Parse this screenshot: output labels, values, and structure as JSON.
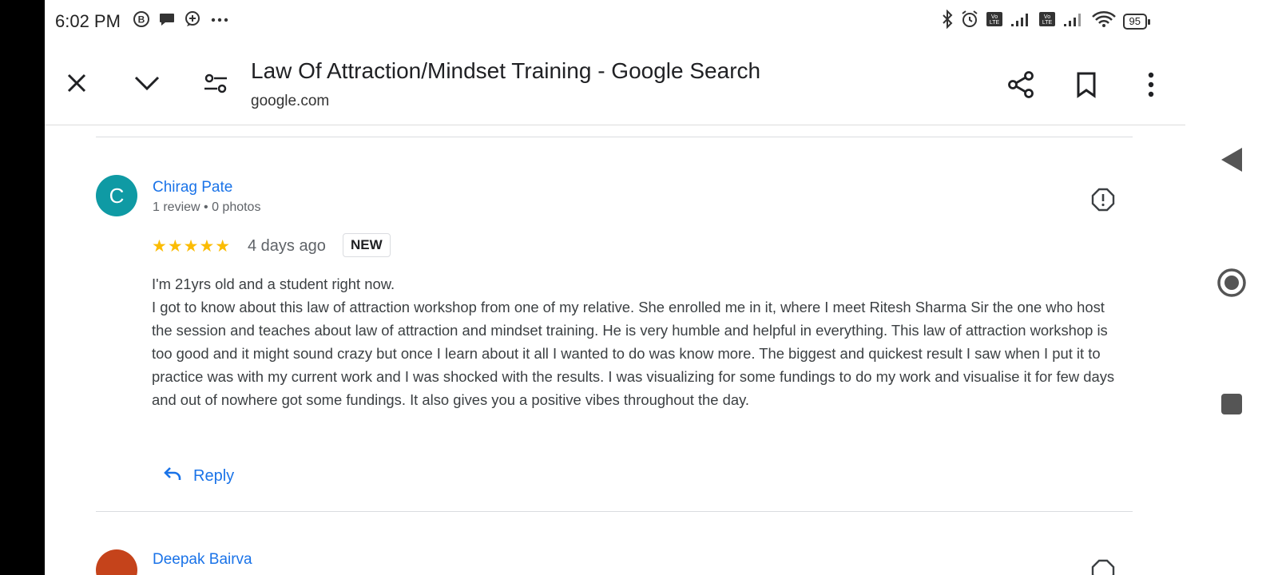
{
  "status_bar": {
    "time": "6:02 PM",
    "left_icons": [
      "b-circle-icon",
      "chat-bubble-icon",
      "plus-bubble-icon",
      "more-horiz-icon"
    ],
    "right_icons": [
      "bluetooth-icon",
      "alarm-icon",
      "volte-icon",
      "signal-icon",
      "volte-icon",
      "signal-icon",
      "wifi-icon"
    ],
    "battery": "95"
  },
  "toolbar": {
    "title": "Law Of Attraction/Mindset Training - Google Search",
    "domain": "google.com",
    "left_icons": [
      "close-icon",
      "chevron-down-icon",
      "page-settings-icon"
    ],
    "right_icons": [
      "share-icon",
      "bookmark-icon",
      "more-vert-icon"
    ]
  },
  "review": {
    "avatar_letter": "C",
    "avatar_color": "#0f9aa4",
    "reviewer_name": "Chirag Pate",
    "reviewer_meta": "1 review • 0 photos",
    "stars": "★★★★★",
    "rating": 5,
    "date": "4 days ago",
    "badge": "NEW",
    "text_line1": "I'm 21yrs old and a student right now.",
    "text_body": "I got to know about this law of attraction workshop from one of my relative. She enrolled me in it, where I meet Ritesh Sharma Sir the one who host the session and teaches about law of attraction and mindset training. He is very humble and helpful in everything. This law of attraction workshop is too good and it might sound crazy but once I learn about it all I wanted to do was know more. The biggest and quickest result I saw when I put it to practice was with my current work and I was shocked with the results. I was visualizing for some fundings to do my work and visualise it for few days and out of nowhere got some fundings. It also gives you a positive vibes throughout the day.",
    "reply_label": "Reply"
  },
  "next_review": {
    "reviewer_name": "Deepak Bairva",
    "avatar_color": "#c5431b"
  },
  "accent_color": "#1a73e8",
  "star_color": "#fbbc04"
}
